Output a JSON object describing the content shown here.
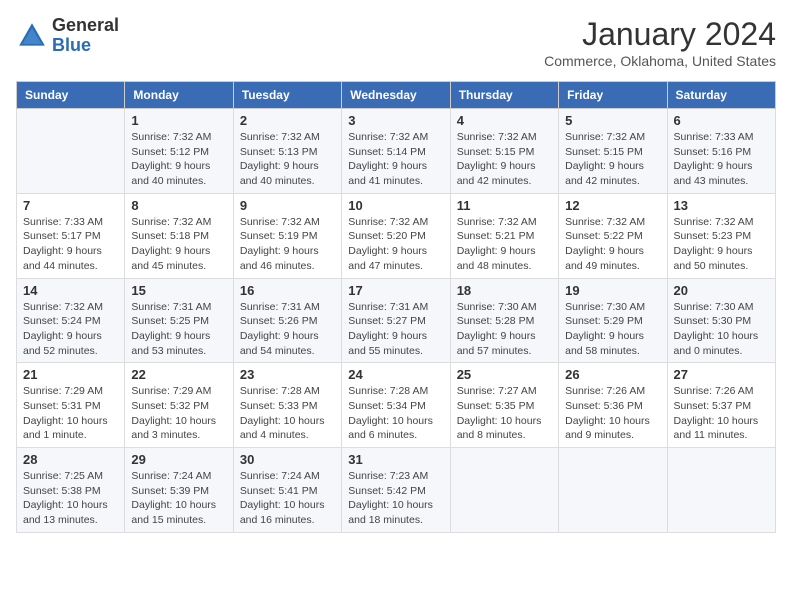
{
  "header": {
    "logo_line1": "General",
    "logo_line2": "Blue",
    "month": "January 2024",
    "location": "Commerce, Oklahoma, United States"
  },
  "weekdays": [
    "Sunday",
    "Monday",
    "Tuesday",
    "Wednesday",
    "Thursday",
    "Friday",
    "Saturday"
  ],
  "weeks": [
    [
      {
        "num": "",
        "info": ""
      },
      {
        "num": "1",
        "info": "Sunrise: 7:32 AM\nSunset: 5:12 PM\nDaylight: 9 hours\nand 40 minutes."
      },
      {
        "num": "2",
        "info": "Sunrise: 7:32 AM\nSunset: 5:13 PM\nDaylight: 9 hours\nand 40 minutes."
      },
      {
        "num": "3",
        "info": "Sunrise: 7:32 AM\nSunset: 5:14 PM\nDaylight: 9 hours\nand 41 minutes."
      },
      {
        "num": "4",
        "info": "Sunrise: 7:32 AM\nSunset: 5:15 PM\nDaylight: 9 hours\nand 42 minutes."
      },
      {
        "num": "5",
        "info": "Sunrise: 7:32 AM\nSunset: 5:15 PM\nDaylight: 9 hours\nand 42 minutes."
      },
      {
        "num": "6",
        "info": "Sunrise: 7:33 AM\nSunset: 5:16 PM\nDaylight: 9 hours\nand 43 minutes."
      }
    ],
    [
      {
        "num": "7",
        "info": "Sunrise: 7:33 AM\nSunset: 5:17 PM\nDaylight: 9 hours\nand 44 minutes."
      },
      {
        "num": "8",
        "info": "Sunrise: 7:32 AM\nSunset: 5:18 PM\nDaylight: 9 hours\nand 45 minutes."
      },
      {
        "num": "9",
        "info": "Sunrise: 7:32 AM\nSunset: 5:19 PM\nDaylight: 9 hours\nand 46 minutes."
      },
      {
        "num": "10",
        "info": "Sunrise: 7:32 AM\nSunset: 5:20 PM\nDaylight: 9 hours\nand 47 minutes."
      },
      {
        "num": "11",
        "info": "Sunrise: 7:32 AM\nSunset: 5:21 PM\nDaylight: 9 hours\nand 48 minutes."
      },
      {
        "num": "12",
        "info": "Sunrise: 7:32 AM\nSunset: 5:22 PM\nDaylight: 9 hours\nand 49 minutes."
      },
      {
        "num": "13",
        "info": "Sunrise: 7:32 AM\nSunset: 5:23 PM\nDaylight: 9 hours\nand 50 minutes."
      }
    ],
    [
      {
        "num": "14",
        "info": "Sunrise: 7:32 AM\nSunset: 5:24 PM\nDaylight: 9 hours\nand 52 minutes."
      },
      {
        "num": "15",
        "info": "Sunrise: 7:31 AM\nSunset: 5:25 PM\nDaylight: 9 hours\nand 53 minutes."
      },
      {
        "num": "16",
        "info": "Sunrise: 7:31 AM\nSunset: 5:26 PM\nDaylight: 9 hours\nand 54 minutes."
      },
      {
        "num": "17",
        "info": "Sunrise: 7:31 AM\nSunset: 5:27 PM\nDaylight: 9 hours\nand 55 minutes."
      },
      {
        "num": "18",
        "info": "Sunrise: 7:30 AM\nSunset: 5:28 PM\nDaylight: 9 hours\nand 57 minutes."
      },
      {
        "num": "19",
        "info": "Sunrise: 7:30 AM\nSunset: 5:29 PM\nDaylight: 9 hours\nand 58 minutes."
      },
      {
        "num": "20",
        "info": "Sunrise: 7:30 AM\nSunset: 5:30 PM\nDaylight: 10 hours\nand 0 minutes."
      }
    ],
    [
      {
        "num": "21",
        "info": "Sunrise: 7:29 AM\nSunset: 5:31 PM\nDaylight: 10 hours\nand 1 minute."
      },
      {
        "num": "22",
        "info": "Sunrise: 7:29 AM\nSunset: 5:32 PM\nDaylight: 10 hours\nand 3 minutes."
      },
      {
        "num": "23",
        "info": "Sunrise: 7:28 AM\nSunset: 5:33 PM\nDaylight: 10 hours\nand 4 minutes."
      },
      {
        "num": "24",
        "info": "Sunrise: 7:28 AM\nSunset: 5:34 PM\nDaylight: 10 hours\nand 6 minutes."
      },
      {
        "num": "25",
        "info": "Sunrise: 7:27 AM\nSunset: 5:35 PM\nDaylight: 10 hours\nand 8 minutes."
      },
      {
        "num": "26",
        "info": "Sunrise: 7:26 AM\nSunset: 5:36 PM\nDaylight: 10 hours\nand 9 minutes."
      },
      {
        "num": "27",
        "info": "Sunrise: 7:26 AM\nSunset: 5:37 PM\nDaylight: 10 hours\nand 11 minutes."
      }
    ],
    [
      {
        "num": "28",
        "info": "Sunrise: 7:25 AM\nSunset: 5:38 PM\nDaylight: 10 hours\nand 13 minutes."
      },
      {
        "num": "29",
        "info": "Sunrise: 7:24 AM\nSunset: 5:39 PM\nDaylight: 10 hours\nand 15 minutes."
      },
      {
        "num": "30",
        "info": "Sunrise: 7:24 AM\nSunset: 5:41 PM\nDaylight: 10 hours\nand 16 minutes."
      },
      {
        "num": "31",
        "info": "Sunrise: 7:23 AM\nSunset: 5:42 PM\nDaylight: 10 hours\nand 18 minutes."
      },
      {
        "num": "",
        "info": ""
      },
      {
        "num": "",
        "info": ""
      },
      {
        "num": "",
        "info": ""
      }
    ]
  ]
}
